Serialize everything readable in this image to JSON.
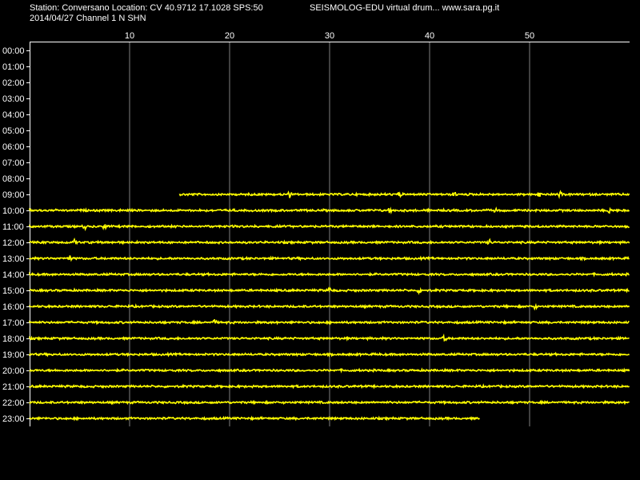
{
  "header": {
    "station_line": "Station: Conversano Location: CV 40.9712 17.1028 SPS:50",
    "date_line": "2014/04/27  Channel 1 N SHN",
    "title": "SEISMOLOG-EDU virtual drum... www.sara.pg.it"
  },
  "chart_data": {
    "type": "line",
    "xlim": [
      0,
      60
    ],
    "x_ticks": [
      "10",
      "20",
      "30",
      "40",
      "50"
    ],
    "x_tick_values": [
      10,
      20,
      30,
      40,
      50
    ],
    "hour_labels": [
      "00:00",
      "01:00",
      "02:00",
      "03:00",
      "04:00",
      "05:00",
      "06:00",
      "07:00",
      "08:00",
      "09:00",
      "10:00",
      "11:00",
      "12:00",
      "13:00",
      "14:00",
      "15:00",
      "16:00",
      "17:00",
      "18:00",
      "19:00",
      "20:00",
      "21:00",
      "22:00",
      "23:00"
    ],
    "grid": true,
    "colors": {
      "trace": "#ffff00",
      "grid": "#808080",
      "axis": "#ffffff",
      "text": "#ffffff",
      "background": "#000000"
    },
    "traces": [
      {
        "hour": "09:00",
        "start_min": 15,
        "end_min": 60,
        "events": [
          26,
          37,
          42.5,
          51,
          53
        ]
      },
      {
        "hour": "10:00",
        "start_min": 0,
        "end_min": 60,
        "events": [
          36,
          46.5,
          58
        ]
      },
      {
        "hour": "11:00",
        "start_min": 0,
        "end_min": 60,
        "events": [
          5.5,
          7.5
        ]
      },
      {
        "hour": "12:00",
        "start_min": 0,
        "end_min": 60,
        "events": [
          4.5,
          46
        ]
      },
      {
        "hour": "13:00",
        "start_min": 0,
        "end_min": 60,
        "events": [
          4
        ]
      },
      {
        "hour": "14:00",
        "start_min": 0,
        "end_min": 60,
        "events": []
      },
      {
        "hour": "15:00",
        "start_min": 0,
        "end_min": 60,
        "events": [
          30,
          39
        ]
      },
      {
        "hour": "16:00",
        "start_min": 0,
        "end_min": 60,
        "events": [
          50.5
        ]
      },
      {
        "hour": "17:00",
        "start_min": 0,
        "end_min": 60,
        "events": [
          18.5
        ]
      },
      {
        "hour": "18:00",
        "start_min": 0,
        "end_min": 60,
        "events": [
          41.5
        ]
      },
      {
        "hour": "19:00",
        "start_min": 0,
        "end_min": 60,
        "events": []
      },
      {
        "hour": "20:00",
        "start_min": 0,
        "end_min": 60,
        "events": []
      },
      {
        "hour": "21:00",
        "start_min": 0,
        "end_min": 60,
        "events": []
      },
      {
        "hour": "22:00",
        "start_min": 0,
        "end_min": 60,
        "events": []
      },
      {
        "hour": "23:00",
        "start_min": 0,
        "end_min": 45,
        "events": []
      }
    ]
  }
}
